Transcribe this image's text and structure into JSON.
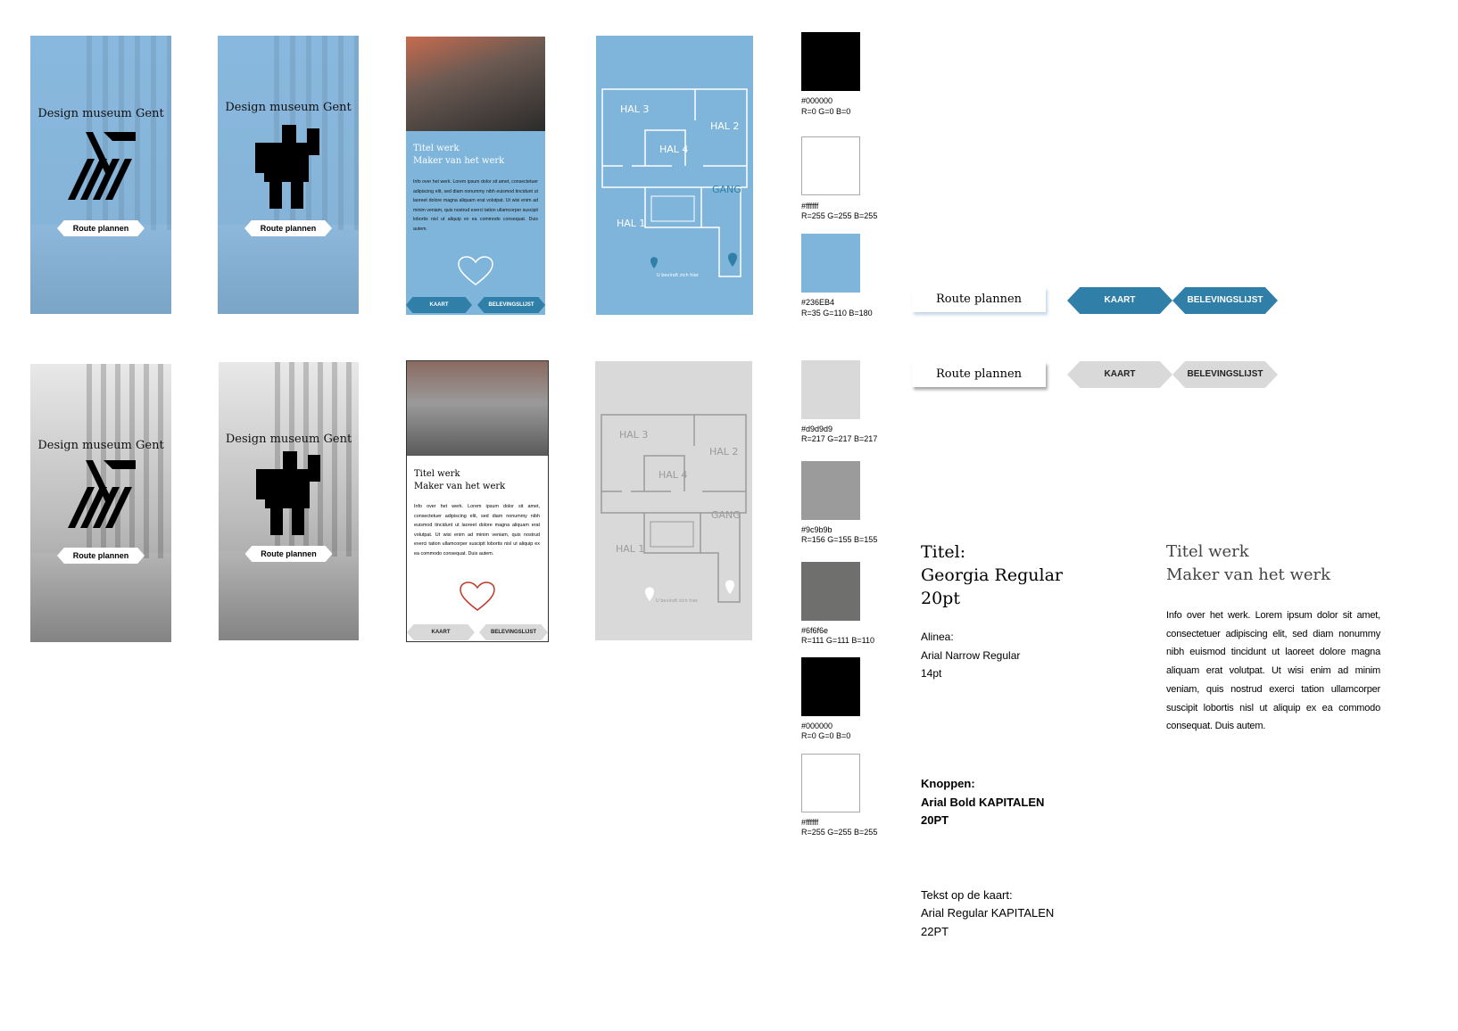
{
  "splash": {
    "title": "Design museum Gent",
    "route_button": "Route plannen"
  },
  "artwork_screen": {
    "title": "Titel werk",
    "maker": "Maker van het werk",
    "info": "Info over het werk. Lorem ipsum dolor sit amet, consectetuer adipiscing elit, sed diam nonummy nibh euismod tincidunt ut laoreet dolore magna aliquam erat volutpat. Ut wisi enim ad minim veniam, quis nostrud exerci tation ullamcorper suscipit lobortis nisl ut aliquip ex ea commodo consequat. Duis autem.",
    "tab_map": "KAART",
    "tab_list": "BELEVINGSLIJST"
  },
  "map_screen": {
    "hal3": "HAL 3",
    "hal2": "HAL 2",
    "hal4": "HAL 4",
    "hal1": "HAL 1",
    "gang": "GANG",
    "you_are_here": "U bevindt zich hier"
  },
  "palette_top": [
    {
      "hex_label": "#000000",
      "rgb": "R=0 G=0 B=0",
      "color": "#000000"
    },
    {
      "hex_label": "#ffffff",
      "rgb": "R=255 G=255 B=255",
      "color": "#ffffff"
    },
    {
      "hex_label": "#236EB4",
      "rgb": "R=35 G=110 B=180",
      "color": "#7fb5da"
    }
  ],
  "palette_bottom": [
    {
      "hex_label": "#d9d9d9",
      "rgb": "R=217 G=217 B=217",
      "color": "#d9d9d9"
    },
    {
      "hex_label": "#9c9b9b",
      "rgb": "R=156 G=155 B=155",
      "color": "#9c9b9b"
    },
    {
      "hex_label": "#6f6f6e",
      "rgb": "R=111 G=111 B=110",
      "color": "#6f6f6e"
    },
    {
      "hex_label": "#000000",
      "rgb": "R=0 G=0 B=0",
      "color": "#000000"
    },
    {
      "hex_label": "#ffffff",
      "rgb": "R=255 G=255 B=255",
      "color": "#ffffff"
    }
  ],
  "buttons_showcase": {
    "route": "Route plannen",
    "kaart": "KAART",
    "belevingslijst": "BELEVINGSLIJST",
    "accent_blue": "#2f7fa8",
    "grey": "#d9d9d9"
  },
  "typography": {
    "title_label": "Titel:",
    "title_font": "Georgia Regular",
    "title_size": "20pt",
    "para_label": "Alinea:",
    "para_font": "Arial Narrow Regular",
    "para_size": "14pt",
    "buttons_label": "Knoppen:",
    "buttons_font": "Arial Bold KAPITALEN",
    "buttons_size": "20PT",
    "map_label": "Tekst op de kaart:",
    "map_font": "Arial Regular KAPITALEN",
    "map_size": "22PT"
  },
  "sample": {
    "title": "Titel werk",
    "maker": "Maker van het werk",
    "paragraph": "Info over het werk. Lorem ipsum dolor sit amet, consectetuer adipiscing elit, sed diam nonummy nibh euismod tincidunt ut laoreet dolore magna aliquam erat volutpat. Ut wisi enim ad minim veniam, quis nostrud exerci tation ullamcorper suscipit lobortis nisl ut aliquip ex ea commodo consequat. Duis autem."
  }
}
